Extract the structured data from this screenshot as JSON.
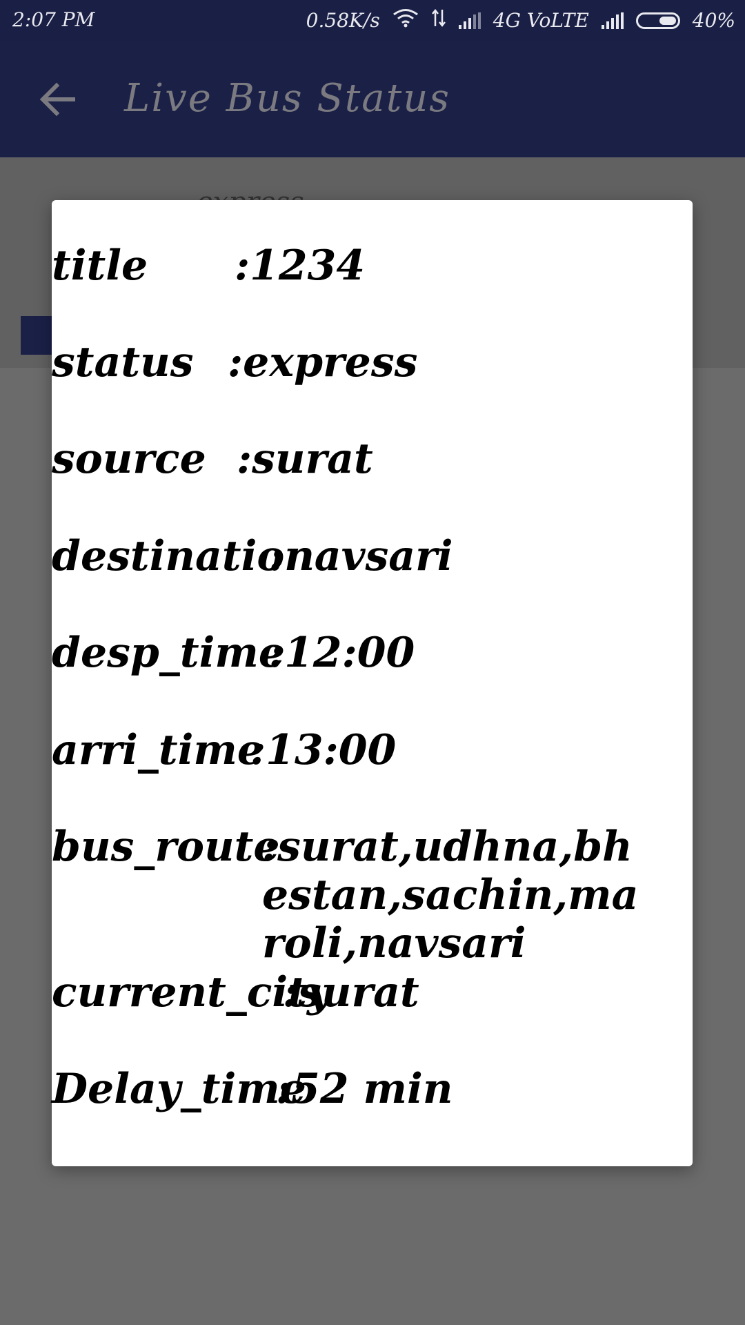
{
  "status_bar": {
    "time": "2:07 PM",
    "speed": "0.58K/s",
    "network": "4G VoLTE",
    "battery": "40%"
  },
  "app_bar": {
    "back_icon": "arrow-left-icon",
    "title": "Live Bus Status"
  },
  "background_page": {
    "status_text": "express"
  },
  "dialog": {
    "rows": [
      {
        "label": "title",
        "value": ":1234"
      },
      {
        "label": "status",
        "value": ":express"
      },
      {
        "label": "source",
        "value": ":surat"
      },
      {
        "label": "destination",
        "value": ":navsari"
      },
      {
        "label": "desp_time",
        "value": ":12:00"
      },
      {
        "label": "arri_time",
        "value": ":13:00"
      },
      {
        "label": "bus_route",
        "value": ":surat,udhna,bhestan,sachin,maroli,navsari"
      },
      {
        "label": "current_city",
        "value": ":surat"
      },
      {
        "label": "Delay_time",
        "value": ":52 min"
      }
    ]
  },
  "colors": {
    "app_bar": "#1b2047",
    "scrim": "#6b6b6b",
    "dialog_bg": "#ffffff"
  }
}
